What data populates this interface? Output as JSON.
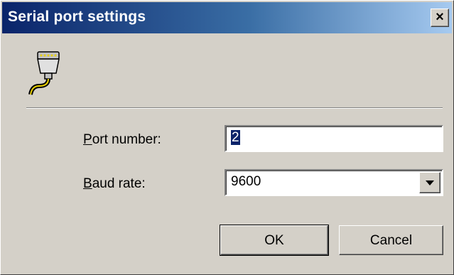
{
  "window": {
    "title": "Serial port settings",
    "close_glyph": "✕",
    "icon": "serial-port-connector-icon"
  },
  "form": {
    "port_label_mnemonic": "P",
    "port_label_rest": "ort number:",
    "port_value": "2",
    "baud_label_mnemonic": "B",
    "baud_label_rest": "aud rate:",
    "baud_value": "9600"
  },
  "buttons": {
    "ok": "OK",
    "cancel": "Cancel"
  },
  "colors": {
    "titlebar_start": "#0a246a",
    "titlebar_end": "#a6caf0",
    "face": "#d4d0c8"
  }
}
